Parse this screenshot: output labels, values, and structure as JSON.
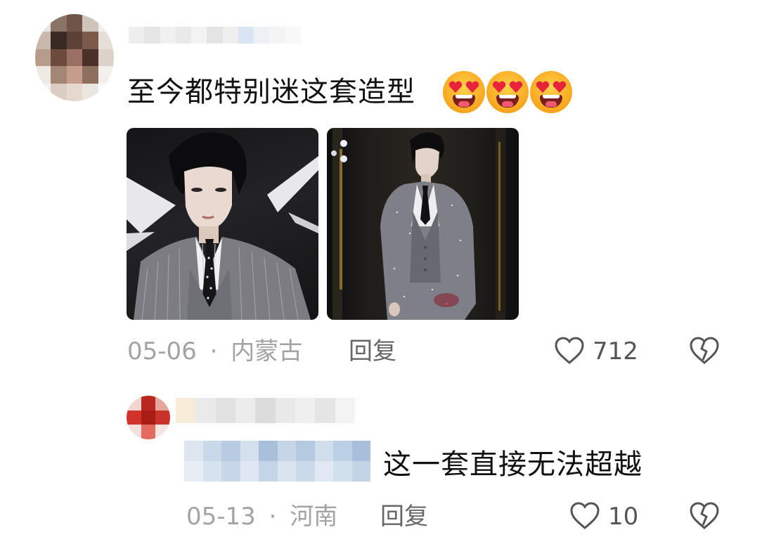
{
  "comment": {
    "text": "至今都特别迷这套造型",
    "emoji_name": "heart-eyes-emoji",
    "emoji_count": 3,
    "images": [
      {
        "name": "suit-photo-portrait"
      },
      {
        "name": "suit-photo-runway"
      }
    ],
    "date": "05-06",
    "separator": "·",
    "location": "内蒙古",
    "reply_label": "回复",
    "like_count": "712",
    "like_icon": "heart-outline-icon",
    "dislike_icon": "broken-heart-icon"
  },
  "reply": {
    "text": "这一套直接无法超越",
    "date": "05-13",
    "separator": "·",
    "location": "河南",
    "reply_label": "回复",
    "like_count": "10",
    "like_icon": "heart-outline-icon",
    "dislike_icon": "broken-heart-icon"
  },
  "colors": {
    "text_primary": "#111111",
    "meta_gray": "#a3a3a3",
    "reply_gray": "#666666"
  }
}
